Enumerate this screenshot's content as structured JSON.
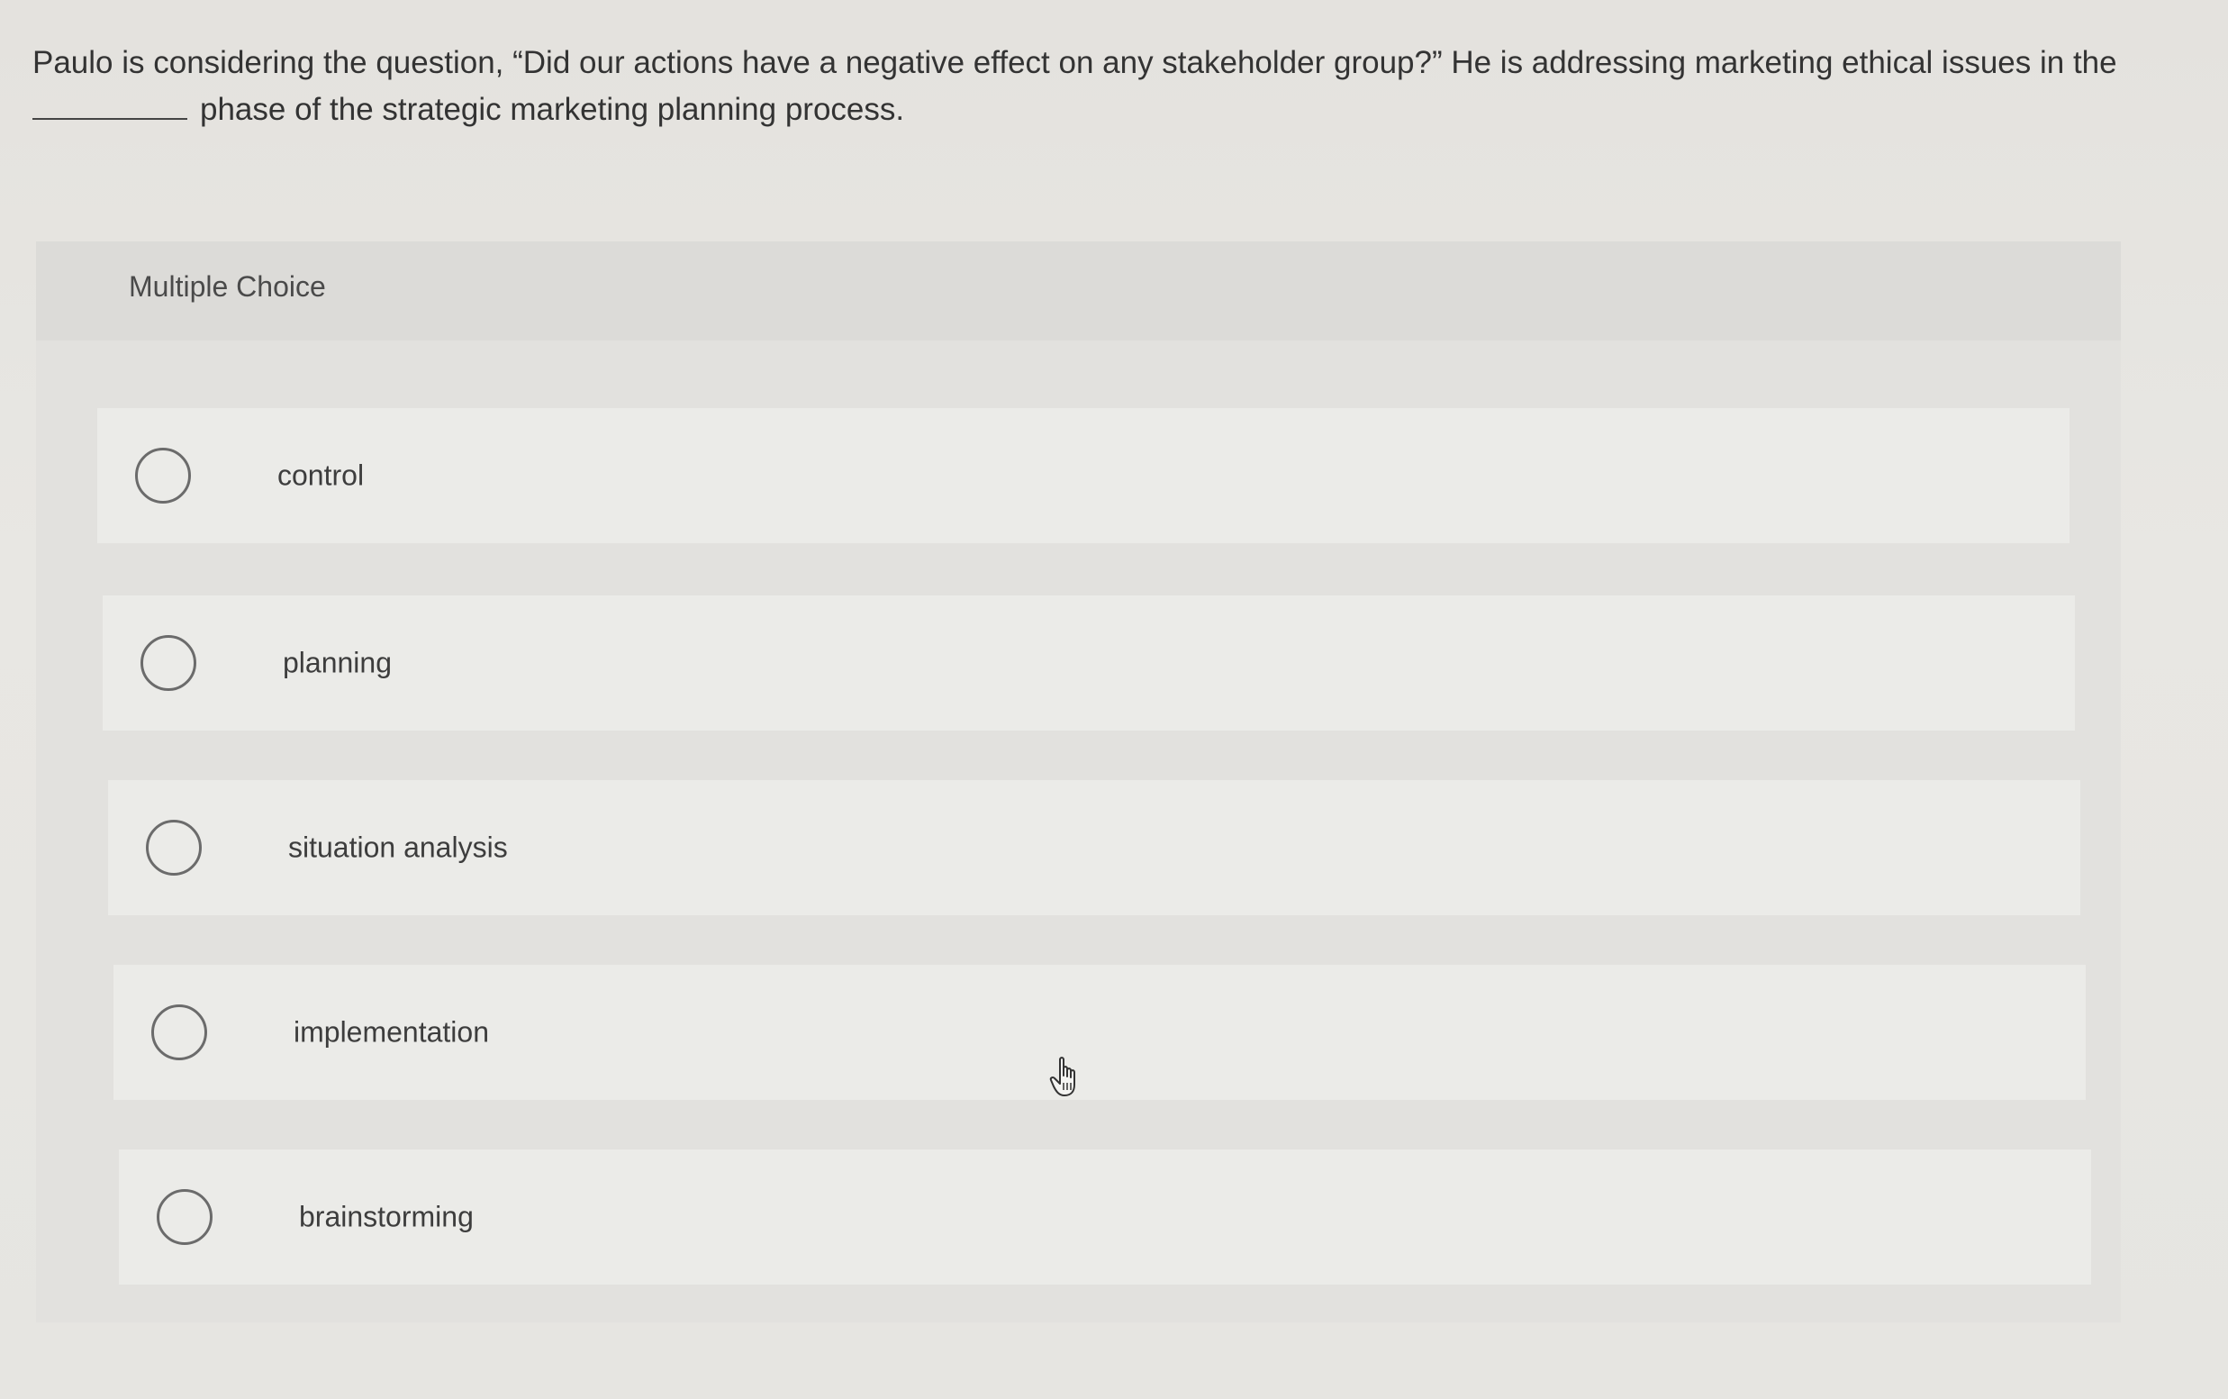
{
  "question": {
    "line1": "Paulo is considering the question, “Did our actions have a negative effect on any stakeholder group?” He is addressing marketing ethical issues in the",
    "line2": "phase of the strategic marketing planning process."
  },
  "multiple_choice": {
    "title": "Multiple Choice",
    "options": [
      {
        "label": "control"
      },
      {
        "label": "planning"
      },
      {
        "label": "situation analysis"
      },
      {
        "label": "implementation"
      },
      {
        "label": "brainstorming"
      }
    ]
  },
  "icons": {
    "cursor": "hand-pointer-icon",
    "radio": "radio-button-unchecked-icon"
  }
}
